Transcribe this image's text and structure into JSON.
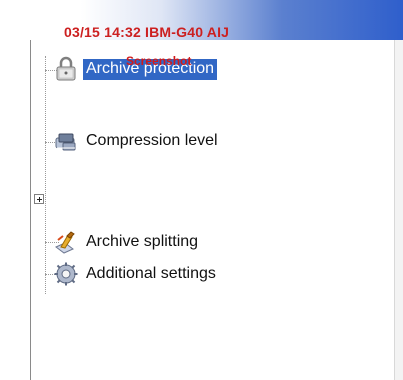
{
  "overlay": {
    "top_text": "03/15 14:32 IBM-G40 AIJ",
    "selected_text": "Screenshot"
  },
  "tree": {
    "items": [
      {
        "label": "Archive protection",
        "icon": "lock-icon",
        "selected": true
      },
      {
        "label": "Compression level",
        "icon": "compression-icon",
        "selected": false
      },
      {
        "label": "Archive splitting",
        "icon": "split-icon",
        "selected": false
      },
      {
        "label": "Additional settings",
        "icon": "settings-icon",
        "selected": false
      }
    ]
  },
  "colors": {
    "selection": "#3167c5",
    "overlay": "#cc2020",
    "title_bar": "#2f5fcc"
  }
}
